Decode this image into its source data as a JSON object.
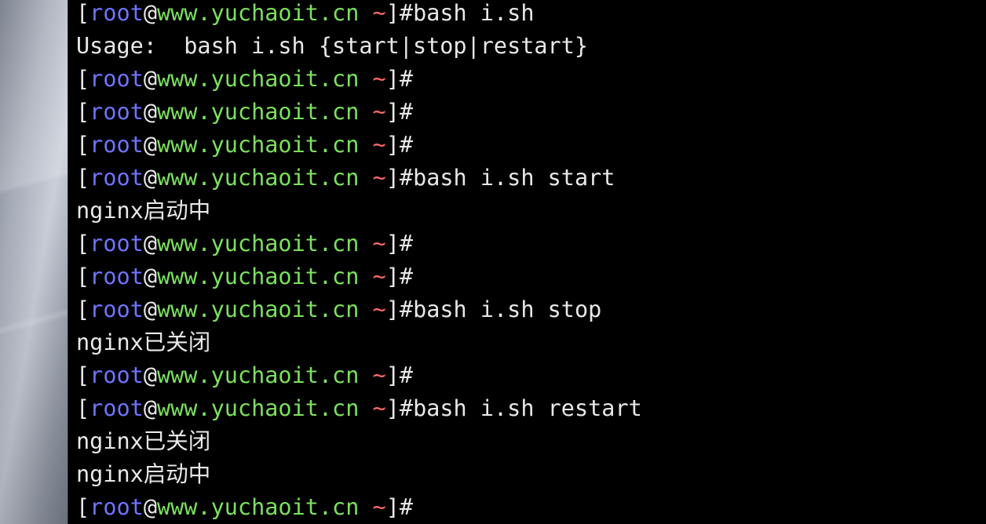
{
  "colors": {
    "user": "#6f74ff",
    "host": "#7be05d",
    "path": "#ff6b6b",
    "text": "#e8e8e8",
    "background": "#000000"
  },
  "prompt": {
    "open": "[",
    "user": "root",
    "at": "@",
    "host": "www.yuchaoit.cn",
    "space": " ",
    "path": "~",
    "close": "]",
    "symbol": "#"
  },
  "lines": [
    {
      "type": "prompt",
      "command": "bash i.sh"
    },
    {
      "type": "output",
      "text": "Usage:  bash i.sh {start|stop|restart}"
    },
    {
      "type": "prompt",
      "command": ""
    },
    {
      "type": "prompt",
      "command": ""
    },
    {
      "type": "prompt",
      "command": ""
    },
    {
      "type": "prompt",
      "command": "bash i.sh start"
    },
    {
      "type": "output",
      "text": "nginx启动中"
    },
    {
      "type": "prompt",
      "command": ""
    },
    {
      "type": "prompt",
      "command": ""
    },
    {
      "type": "prompt",
      "command": "bash i.sh stop"
    },
    {
      "type": "output",
      "text": "nginx已关闭"
    },
    {
      "type": "prompt",
      "command": ""
    },
    {
      "type": "prompt",
      "command": "bash i.sh restart"
    },
    {
      "type": "output",
      "text": "nginx已关闭"
    },
    {
      "type": "output",
      "text": "nginx启动中"
    },
    {
      "type": "prompt",
      "command": ""
    }
  ]
}
